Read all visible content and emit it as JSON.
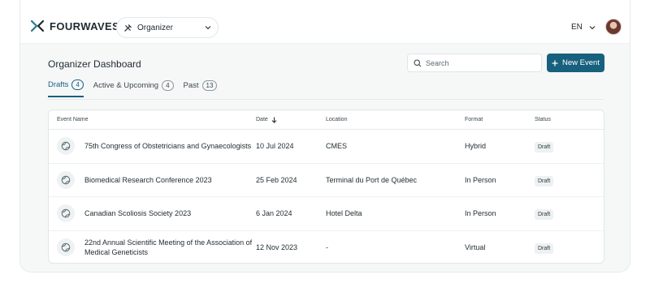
{
  "brand": {
    "name": "FOURWAVES"
  },
  "role_select": {
    "value": "Organizer"
  },
  "language": "EN",
  "page": {
    "title": "Organizer Dashboard"
  },
  "search": {
    "placeholder": "Search"
  },
  "new_event_label": "New Event",
  "tabs": [
    {
      "label": "Drafts",
      "count": "4"
    },
    {
      "label": "Active & Upcoming",
      "count": "4"
    },
    {
      "label": "Past",
      "count": "13"
    }
  ],
  "table": {
    "headers": {
      "name": "Event Name",
      "date": "Date",
      "location": "Location",
      "format": "Format",
      "status": "Status"
    },
    "rows": [
      {
        "name": "75th Congress of Obstetricians and Gynaecologists",
        "date": "10 Jul 2024",
        "location": "CMES",
        "format": "Hybrid",
        "status": "Draft"
      },
      {
        "name": "Biomedical Research Conference 2023",
        "date": "25 Feb 2024",
        "location": "Terminal du Port de Québec",
        "format": "In Person",
        "status": "Draft"
      },
      {
        "name": "Canadian Scoliosis Society 2023",
        "date": "6 Jan 2024",
        "location": "Hotel Delta",
        "format": "In Person",
        "status": "Draft"
      },
      {
        "name": "22nd Annual Scientific Meeting of the Association of Medical Geneticists",
        "date": "12 Nov 2023",
        "location": "-",
        "format": "Virtual",
        "status": "Draft"
      }
    ]
  },
  "colors": {
    "accent": "#17607e",
    "brand_mark": "#2a7a8c"
  }
}
